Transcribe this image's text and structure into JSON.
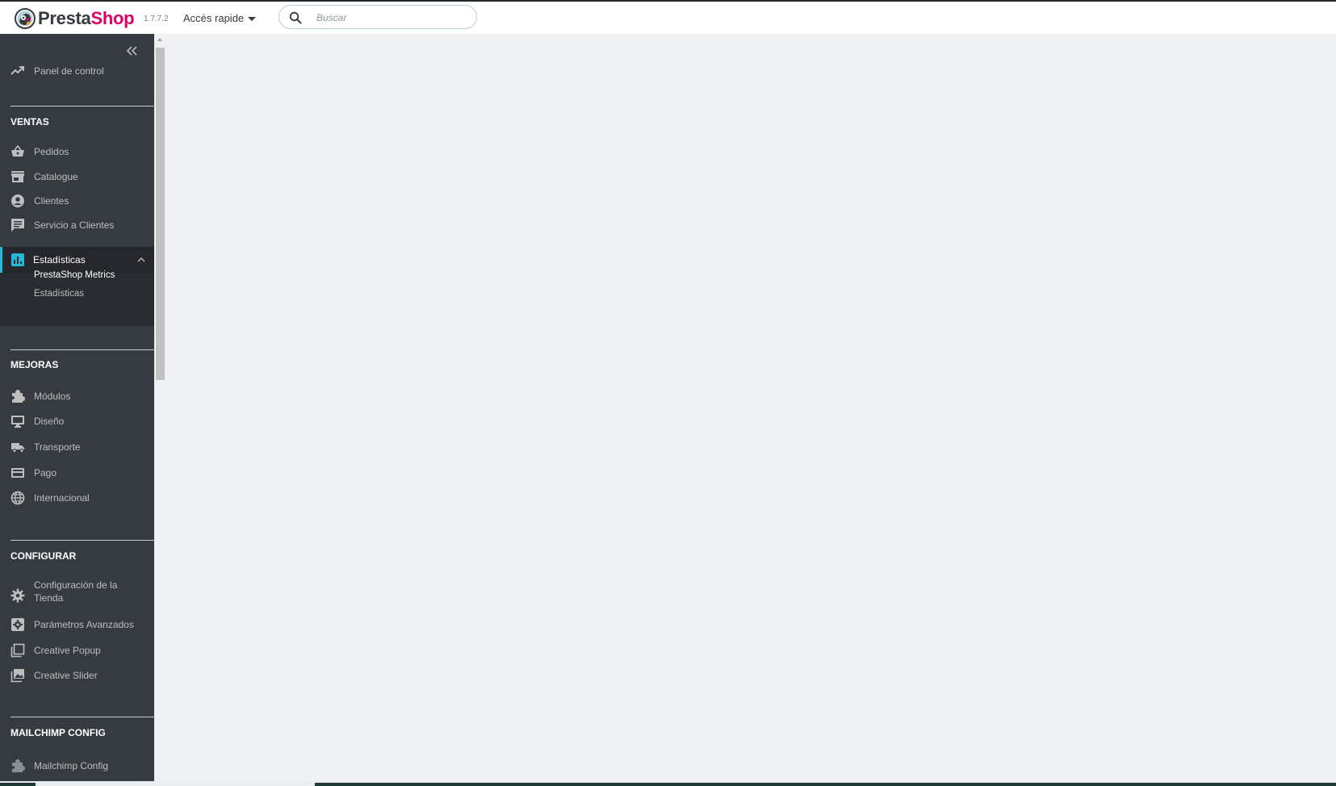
{
  "header": {
    "brand_part1": "Presta",
    "brand_part2": "Shop",
    "version": "1.7.7.2",
    "quick_access": "Accès rapide",
    "search_placeholder": "Buscar"
  },
  "sidebar": {
    "dashboard": "Panel de control",
    "sections": [
      {
        "title": "VENTAS",
        "items": [
          "Pedidos",
          "Catalogue",
          "Clientes",
          "Servicio a Clientes",
          "Estadísticas"
        ]
      },
      {
        "title": "MEJORAS",
        "items": [
          "Módulos",
          "Diseño",
          "Transporte",
          "Pago",
          "Internacional"
        ]
      },
      {
        "title": "CONFIGURAR",
        "items": [
          "Configuración de la Tienda",
          "Parámetros Avanzados",
          "Creative Popup",
          "Creative Slider"
        ]
      },
      {
        "title": "MAILCHIMP CONFIG",
        "items": [
          "Mailchimp Config"
        ]
      }
    ],
    "active_submenu": [
      "PrestaShop Metrics",
      "Estadísticas"
    ]
  },
  "colors": {
    "brand_pink": "#df0067",
    "sidebar_bg": "#363a41",
    "active_accent": "#25b9d7",
    "content_bg": "#eff1f2"
  },
  "icons": {
    "dashboard": "trending-up-icon",
    "pedidos": "basket-icon",
    "catalogue": "store-icon",
    "clientes": "account-circle-icon",
    "servicio": "chat-icon",
    "estadisticas": "bar-chart-icon",
    "modulos": "puzzle-icon",
    "diseno": "desktop-icon",
    "transporte": "truck-icon",
    "pago": "credit-card-icon",
    "internacional": "globe-icon",
    "configuracion": "gear-icon",
    "parametros": "settings-box-icon",
    "popup": "library-icon",
    "slider": "image-icon",
    "mailchimp": "puzzle-icon"
  }
}
